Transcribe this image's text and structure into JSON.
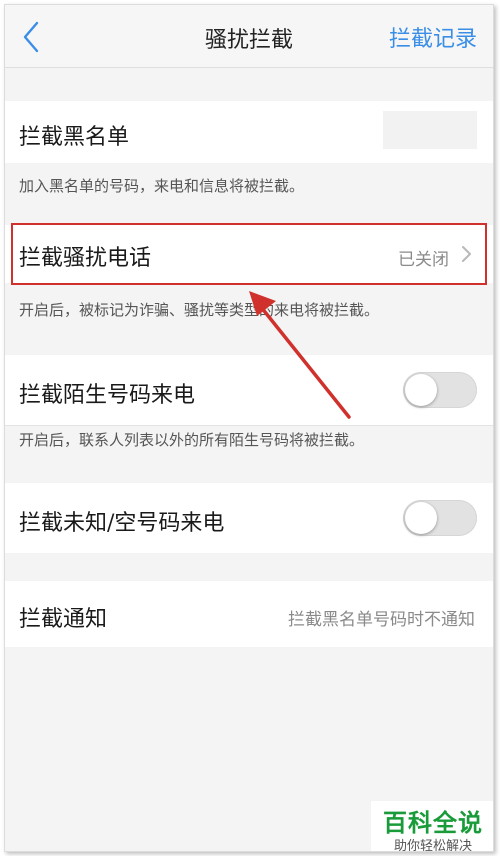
{
  "navbar": {
    "title": "骚扰拦截",
    "action_label": "拦截记录",
    "action_color": "#3a8ee6",
    "back_icon": "chevron-left-icon"
  },
  "sections": {
    "blacklist": {
      "label": "拦截黑名单",
      "description": "加入黑名单的号码，来电和信息将被拦截。"
    },
    "harassment_calls": {
      "label": "拦截骚扰电话",
      "value": "已关闭",
      "description": "开启后，被标记为诈骗、骚扰等类型的来电将被拦截。"
    },
    "stranger_calls": {
      "label": "拦截陌生号码来电",
      "toggle_on": false,
      "description": "开启后，联系人列表以外的所有陌生号码将被拦截。"
    },
    "unknown_calls": {
      "label": "拦截未知/空号码来电",
      "toggle_on": false
    },
    "notification": {
      "label": "拦截通知",
      "value": "拦截黑名单号码时不通知"
    }
  },
  "annotation": {
    "highlight_color": "#d0312d"
  },
  "watermark": {
    "main": "百科全说",
    "sub": "助你轻松解决"
  }
}
